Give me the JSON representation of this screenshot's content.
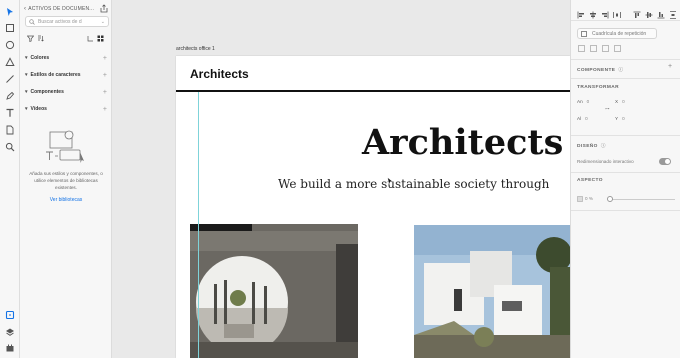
{
  "tools": [
    {
      "icon": "select-arrow-icon"
    },
    {
      "icon": "rectangle-icon"
    },
    {
      "icon": "ellipse-icon"
    },
    {
      "icon": "polygon-icon"
    },
    {
      "icon": "line-icon"
    },
    {
      "icon": "pen-icon"
    },
    {
      "icon": "text-icon"
    },
    {
      "icon": "artboard-icon"
    },
    {
      "icon": "zoom-icon"
    }
  ],
  "bottom_tools": [
    {
      "icon": "document-assets-icon"
    },
    {
      "icon": "layers-icon"
    },
    {
      "icon": "plugins-icon"
    }
  ],
  "assets": {
    "title": "ACTIVOS DE DOCUMEN...",
    "search_placeholder": "Buscar activos de d",
    "sections": [
      {
        "label": "Colores"
      },
      {
        "label": "Estilos de caracteres"
      },
      {
        "label": "Componentes"
      },
      {
        "label": "Vídeos"
      }
    ],
    "empty_text": "Añada sus estilos y componentes, o utilice elementos de bibliotecas existentes.",
    "view_libraries": "Ver bibliotecas"
  },
  "canvas": {
    "artboard_name": "architects office 1",
    "site_logo": "Architects",
    "hero_title": "Architects O",
    "hero_subtitle": "We build a more sustainable society through"
  },
  "props": {
    "repeat_grid": "Cuadrícula de repetición",
    "component_title": "COMPONENTE",
    "transform_title": "TRANSFORMAR",
    "transform": {
      "w_label": "An",
      "w_value": "0",
      "x_label": "X",
      "x_value": "0",
      "h_label": "Al",
      "h_value": "0",
      "y_label": "Y",
      "y_value": "0"
    },
    "design_title": "DISEÑO",
    "responsive_resize": "Redimensionado interactivo",
    "appearance_title": "ASPECTO",
    "opacity_value": "0 %"
  }
}
